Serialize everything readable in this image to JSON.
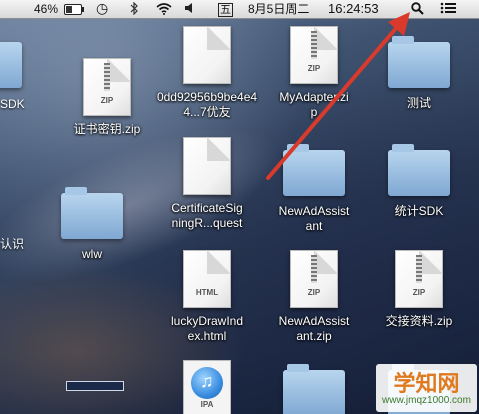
{
  "menubar": {
    "battery_percent": "46%",
    "battery_level": 0.46,
    "input_method": "五",
    "date": "8月5日周二",
    "time": "16:24:53",
    "icons": [
      "battery-icon",
      "time-machine-icon",
      "bluetooth-icon",
      "wifi-icon",
      "volume-icon",
      "spotlight-icon",
      "notification-list-icon"
    ]
  },
  "desktop": {
    "items": [
      {
        "name": "0dd92956b9be4e44...7优友",
        "kind": "document"
      },
      {
        "name": "MyAdapter.zip",
        "kind": "zip",
        "tag": "ZIP",
        "label_line1": "MyAdapter.zi",
        "label_line2": "p"
      },
      {
        "name": "证书密钥.zip",
        "kind": "zip",
        "tag": "ZIP"
      },
      {
        "name": "测试",
        "kind": "folder"
      },
      {
        "name": "CertificateSigningR...quest",
        "kind": "document",
        "label_line1": "CertificateSig",
        "label_line2": "ningR...quest"
      },
      {
        "name": "NewAdAssistant",
        "kind": "folder",
        "label_line1": "NewAdAssist",
        "label_line2": "ant"
      },
      {
        "name": "统计SDK",
        "kind": "folder"
      },
      {
        "name": "wlw",
        "kind": "folder"
      },
      {
        "name": "luckyDrawIndex.html",
        "kind": "html",
        "tag": "HTML",
        "label_line1": "luckyDrawInd",
        "label_line2": "ex.html"
      },
      {
        "name": "NewAdAssistant.zip",
        "kind": "zip",
        "tag": "ZIP",
        "label_line1": "NewAdAssist",
        "label_line2": "ant.zip"
      },
      {
        "name": "交接资料.zip",
        "kind": "zip",
        "tag": "ZIP"
      },
      {
        "name": "",
        "kind": "ipa",
        "tag": "IPA"
      }
    ],
    "partial_labels": [
      "SDK",
      "认识"
    ]
  },
  "watermark": {
    "title": "学知网",
    "url": "www.jmqz1000.com"
  },
  "colors": {
    "arrow": "#d93a2b",
    "folder": "#8fb6de",
    "menubar": "#e6e6e6"
  }
}
